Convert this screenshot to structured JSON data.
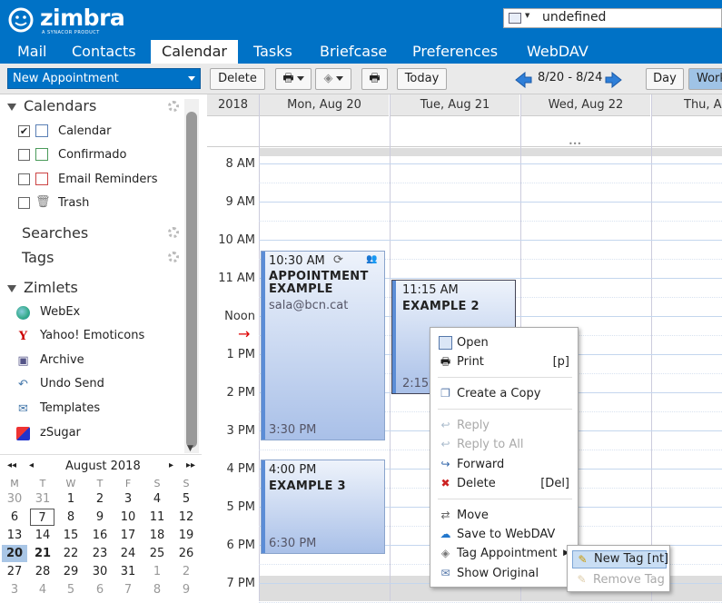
{
  "app": {
    "brand": "zimbra",
    "brand_sub": "A SYNACOR PRODUCT"
  },
  "search": {
    "value": "undefined"
  },
  "tabs": [
    {
      "label": "Mail"
    },
    {
      "label": "Contacts"
    },
    {
      "label": "Calendar",
      "active": true
    },
    {
      "label": "Tasks"
    },
    {
      "label": "Briefcase"
    },
    {
      "label": "Preferences"
    },
    {
      "label": "WebDAV"
    }
  ],
  "toolbar": {
    "new_appointment": "New Appointment",
    "delete": "Delete",
    "today": "Today",
    "date_range": "8/20 - 8/24",
    "day": "Day",
    "work_week": "Work"
  },
  "sidebar": {
    "calendars_header": "Calendars",
    "calendars": [
      {
        "label": "Calendar",
        "checked": true
      },
      {
        "label": "Confirmado",
        "checked": false
      },
      {
        "label": "Email Reminders",
        "checked": false
      },
      {
        "label": "Trash",
        "checked": false
      }
    ],
    "searches": "Searches",
    "tags": "Tags",
    "zimlets_header": "Zimlets",
    "zimlets": [
      {
        "label": "WebEx"
      },
      {
        "label": "Yahoo! Emoticons"
      },
      {
        "label": "Archive"
      },
      {
        "label": "Undo Send"
      },
      {
        "label": "Templates"
      },
      {
        "label": "zSugar"
      }
    ]
  },
  "mini_cal": {
    "month": "August 2018",
    "day_names": [
      "M",
      "T",
      "W",
      "T",
      "F",
      "S",
      "S"
    ],
    "weeks": [
      [
        "30",
        "31",
        "1",
        "2",
        "3",
        "4",
        "5"
      ],
      [
        "6",
        "7",
        "8",
        "9",
        "10",
        "11",
        "12"
      ],
      [
        "13",
        "14",
        "15",
        "16",
        "17",
        "18",
        "19"
      ],
      [
        "20",
        "21",
        "22",
        "23",
        "24",
        "25",
        "26"
      ],
      [
        "27",
        "28",
        "29",
        "30",
        "31",
        "1",
        "2"
      ],
      [
        "3",
        "4",
        "5",
        "6",
        "7",
        "8",
        "9"
      ]
    ]
  },
  "grid": {
    "year": "2018",
    "days": [
      "Mon, Aug 20",
      "Tue, Aug 21",
      "Wed, Aug 22",
      "Thu, Au"
    ],
    "hours": [
      "8 AM",
      "9 AM",
      "10 AM",
      "11 AM",
      "Noon",
      "1 PM",
      "2 PM",
      "3 PM",
      "4 PM",
      "5 PM",
      "6 PM",
      "7 PM"
    ]
  },
  "appointments": [
    {
      "start": "10:30 AM",
      "name": "APPOINTMENT EXAMPLE",
      "location": "sala@bcn.cat",
      "end": "3:30 PM"
    },
    {
      "start": "11:15 AM",
      "name": "EXAMPLE 2",
      "end": "2:15"
    },
    {
      "start": "4:00 PM",
      "name": "EXAMPLE 3",
      "end": "6:30 PM"
    }
  ],
  "context_menu": [
    {
      "label": "Open",
      "shortcut": ""
    },
    {
      "label": "Print",
      "shortcut": "[p]"
    },
    {
      "label": "Create a Copy",
      "shortcut": ""
    },
    {
      "label": "Reply",
      "shortcut": "",
      "disabled": true
    },
    {
      "label": "Reply to All",
      "shortcut": "",
      "disabled": true
    },
    {
      "label": "Forward",
      "shortcut": ""
    },
    {
      "label": "Delete",
      "shortcut": "[Del]"
    },
    {
      "label": "Move",
      "shortcut": ""
    },
    {
      "label": "Save to WebDAV",
      "shortcut": ""
    },
    {
      "label": "Tag Appointment",
      "shortcut": ""
    },
    {
      "label": "Show Original",
      "shortcut": ""
    }
  ],
  "tag_submenu": [
    {
      "label": "New Tag [nt]"
    },
    {
      "label": "Remove Tag",
      "disabled": true
    }
  ]
}
